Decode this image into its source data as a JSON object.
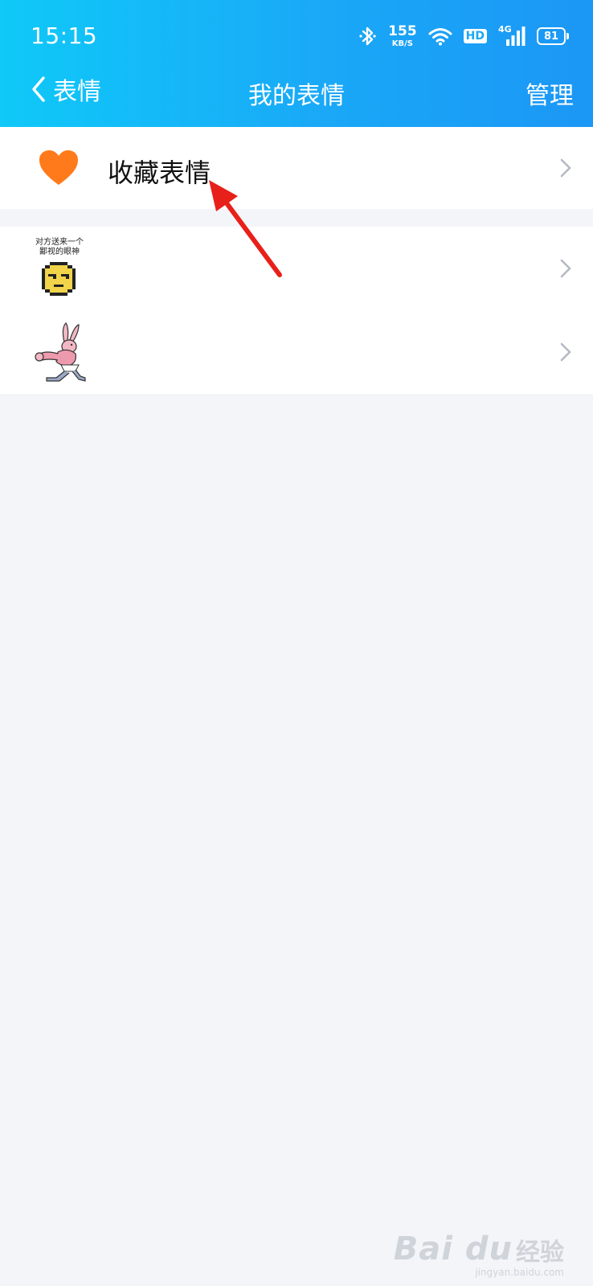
{
  "status_bar": {
    "time": "15:15",
    "net_speed_value": "155",
    "net_speed_unit": "KB/S",
    "hd_label": "HD",
    "signal_label": "4G",
    "battery_level": "81"
  },
  "nav": {
    "back_label": "表情",
    "title": "我的表情",
    "manage_label": "管理"
  },
  "favorites_row": {
    "label": "收藏表情",
    "icon": "heart-icon",
    "icon_color": "#ff7a1a"
  },
  "sticker_packs": [
    {
      "icon": "pixel-smiley-sticker",
      "caption_line1": "对方送来一个",
      "caption_line2": "鄙视的眼神"
    },
    {
      "icon": "muscle-rabbit-sticker"
    }
  ],
  "annotation": {
    "arrow_color": "#e8201a"
  },
  "watermark": {
    "logo": "Bai du",
    "text": "经验",
    "url": "jingyan.baidu.com"
  },
  "colors": {
    "header_start": "#0fc9f8",
    "header_end": "#1b97f5",
    "background": "#f4f5f9",
    "chevron": "#b5b9c2"
  }
}
